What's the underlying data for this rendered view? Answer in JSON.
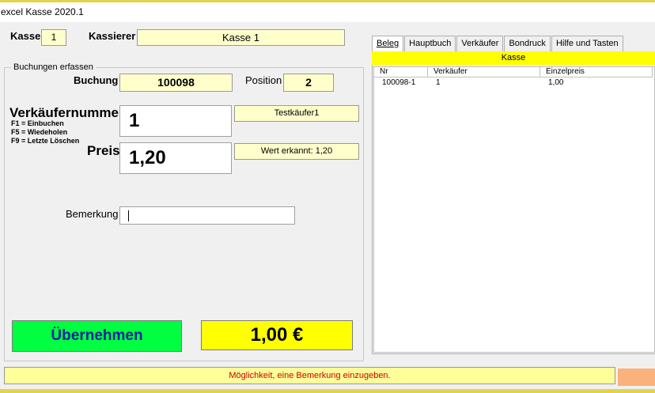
{
  "window": {
    "title": "excel Kasse 2020.1"
  },
  "header": {
    "kasse_label": "Kasse",
    "kasse_value": "1",
    "kassierer_label": "Kassierer",
    "kassierer_value": "Kasse  1"
  },
  "form": {
    "group_label": "Buchungen erfassen",
    "buchung_label": "Buchung",
    "buchung_value": "100098",
    "position_label": "Position",
    "position_value": "2",
    "verkaeufer_label": "Verkäufernummer",
    "verkaeufer_value": "1",
    "verkaeufer_name": "Testkäufer1",
    "hints": [
      "F1 = Einbuchen",
      "F5 = Wiedeholen",
      "F9 = Letzte Löschen"
    ],
    "preis_label": "Preis",
    "preis_value": "1,20",
    "preis_info": "Wert erkannt: 1,20",
    "bemerkung_label": "Bemerkung",
    "bemerkung_value": "",
    "submit_label": "Übernehmen",
    "total": "1,00 €"
  },
  "tabs": [
    {
      "label": "Beleg",
      "active": true
    },
    {
      "label": "Hauptbuch",
      "active": false
    },
    {
      "label": "Verkäufer",
      "active": false
    },
    {
      "label": "Bondruck",
      "active": false
    },
    {
      "label": "Hilfe und Tasten",
      "active": false
    }
  ],
  "panel": {
    "bar_label": "Kasse",
    "columns": [
      "Nr",
      "Verkäufer",
      "Einzelpreis"
    ],
    "rows": [
      [
        "100098-1",
        "1",
        "1,00"
      ]
    ]
  },
  "status": {
    "message": "Möglichkeit, eine Bemerkung einzugeben."
  },
  "colors": {
    "accent_yellow": "#ffff00",
    "field_yellow": "#ffffcc",
    "submit_green": "#00ff40",
    "status_text": "#cc0000"
  }
}
